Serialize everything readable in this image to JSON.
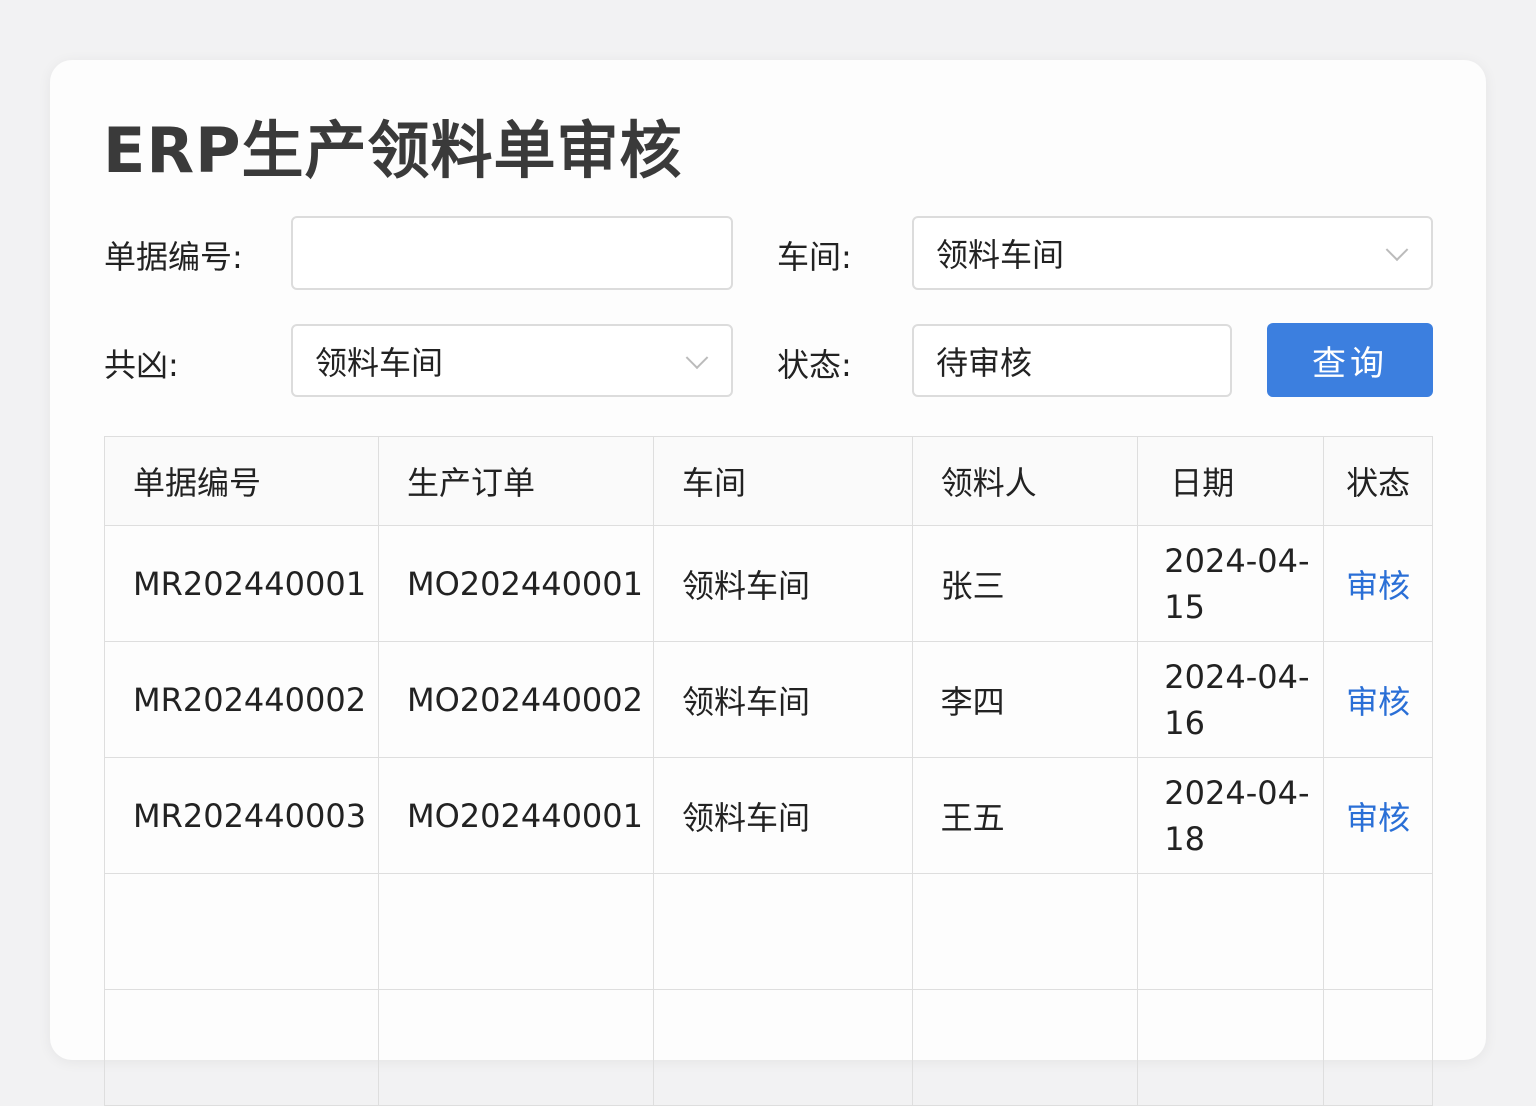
{
  "title": "ERP生产领料单审核",
  "form": {
    "doc_no_label": "单据编号:",
    "doc_no_value": "",
    "workshop_label": "车间:",
    "workshop_value": "领料车间",
    "field3_label": "共凶:",
    "field3_value": "领料车间",
    "status_label": "状态:",
    "status_value": "待审核",
    "query_button": "查询"
  },
  "table": {
    "headers": [
      "单据编号",
      "生产订单",
      "车间",
      "领料人",
      "日期",
      "状态"
    ],
    "rows": [
      [
        "MR202440001",
        "MO202440001",
        "领料车间",
        "张三",
        "2024-04-15",
        "审核"
      ],
      [
        "MR202440002",
        "MO202440002",
        "领料车间",
        "李四",
        "2024-04-16",
        "审核"
      ],
      [
        "MR202440003",
        "MO202440001",
        "领料车间",
        "王五",
        "2024-04-18",
        "审核"
      ]
    ]
  }
}
